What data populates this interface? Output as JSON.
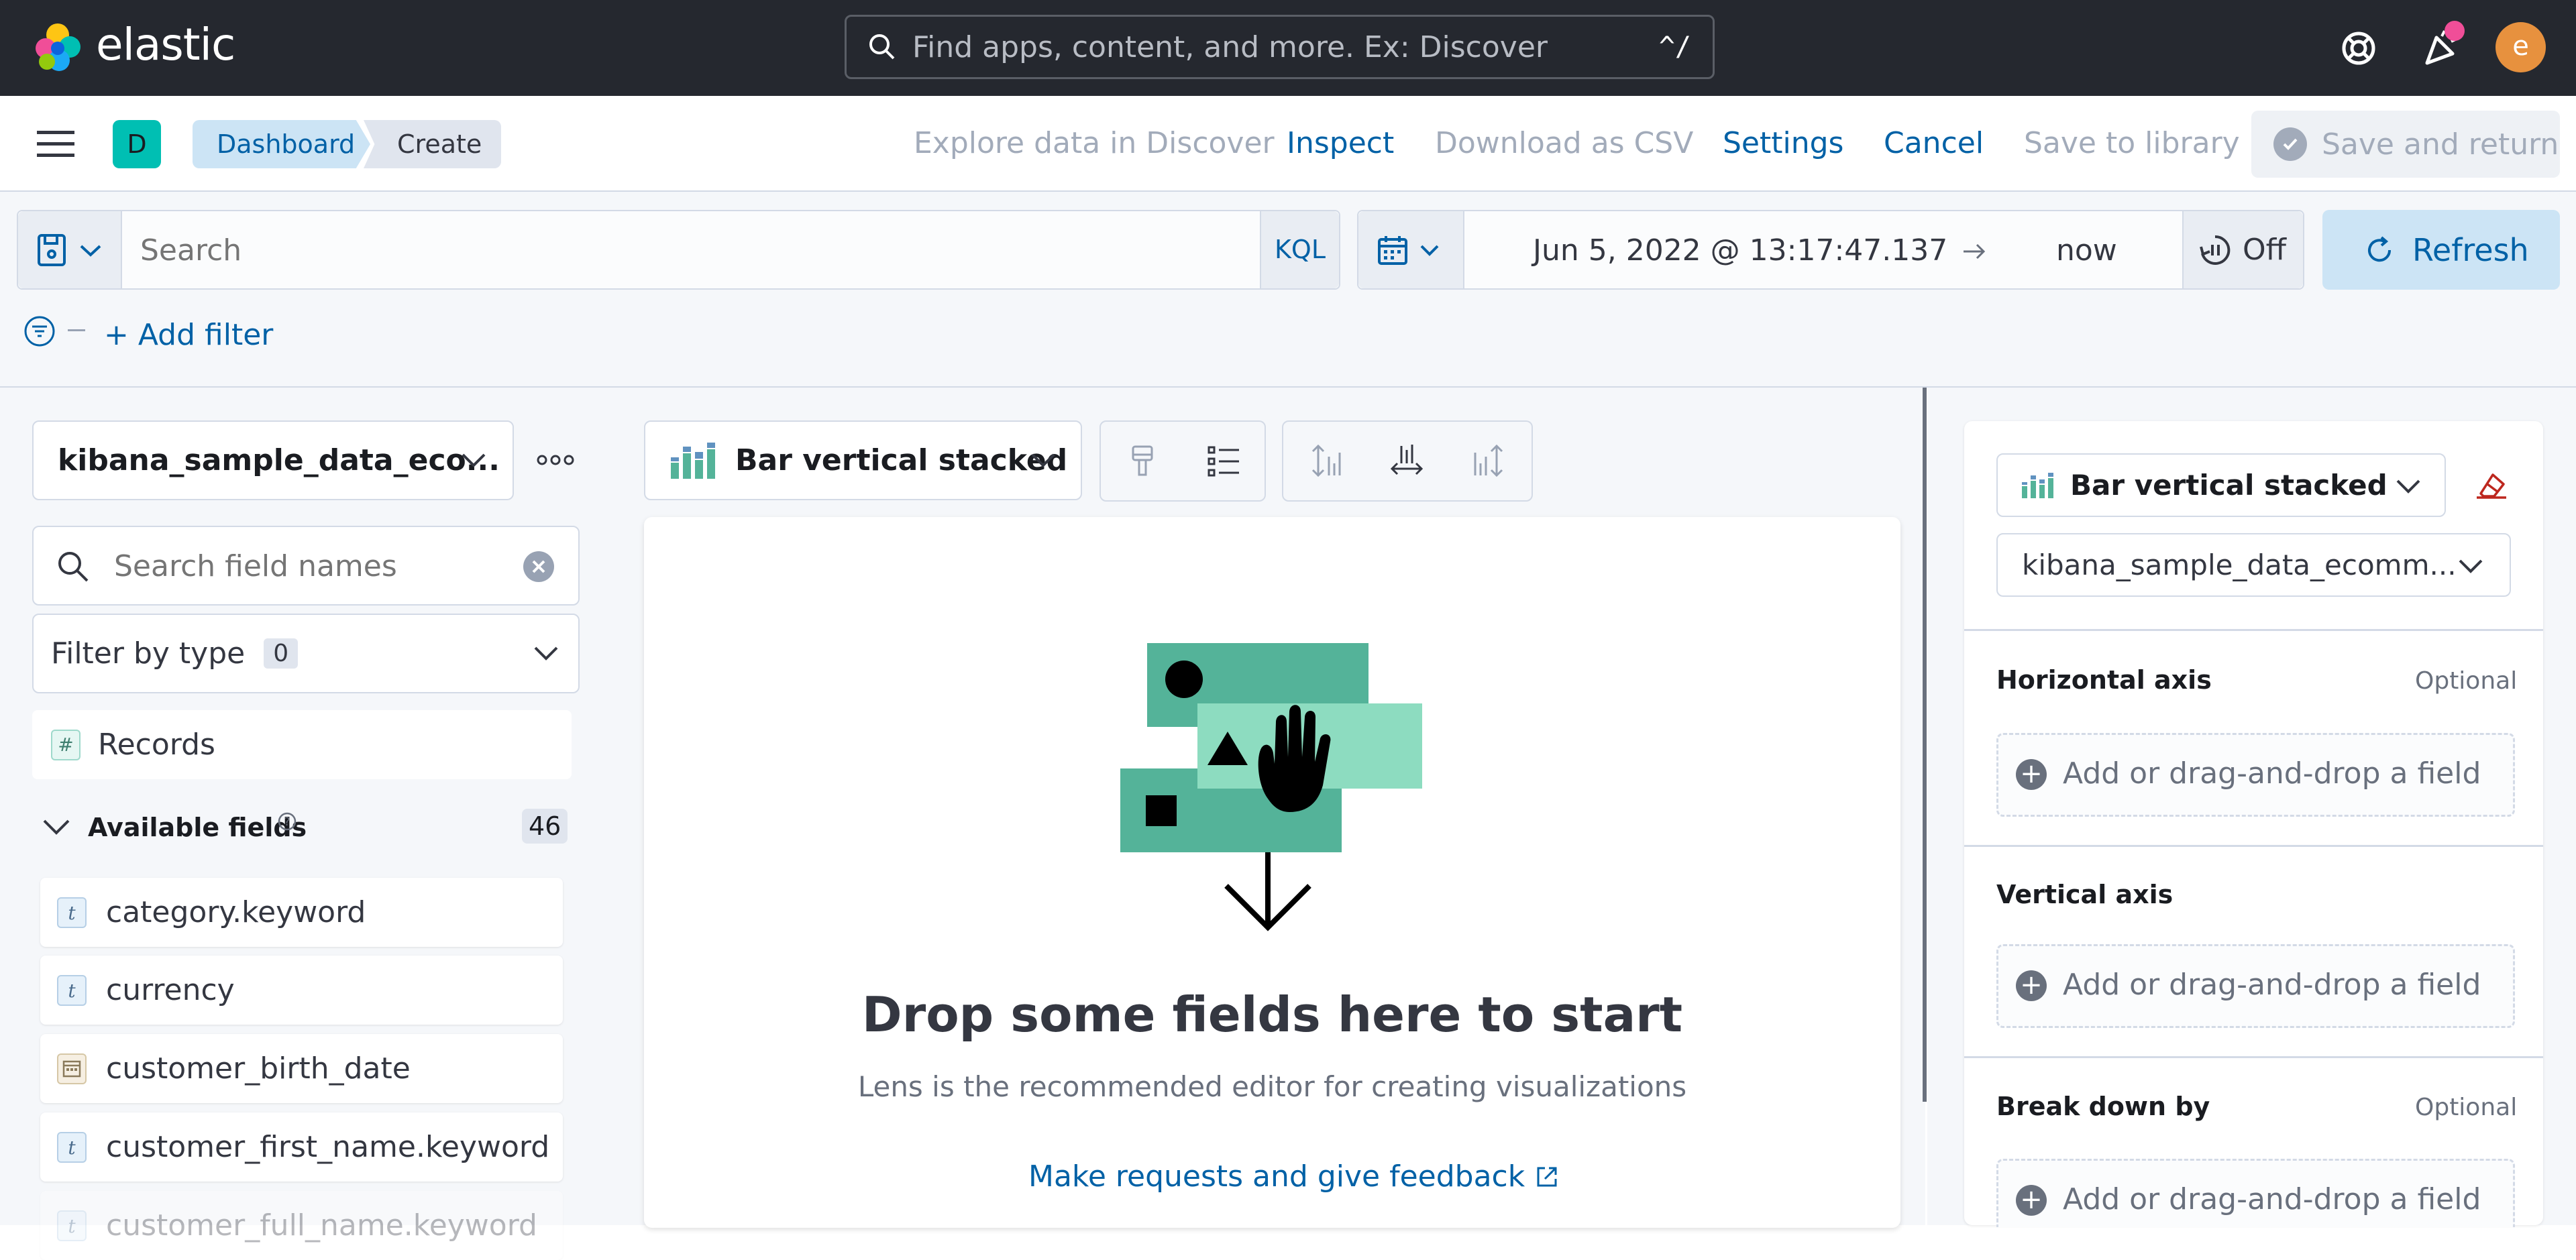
{
  "header": {
    "brand": "elastic",
    "search_placeholder": "Find apps, content, and more. Ex: Discover",
    "search_shortcut": "^/",
    "avatar_letter": "e"
  },
  "nav": {
    "space_letter": "D",
    "breadcrumbs": [
      "Dashboard",
      "Create"
    ],
    "links": {
      "explore": "Explore data in Discover",
      "inspect": "Inspect",
      "download": "Download as CSV",
      "settings": "Settings",
      "cancel": "Cancel",
      "save_library": "Save to library",
      "save_return": "Save and return"
    }
  },
  "query": {
    "search_placeholder": "Search",
    "language": "KQL",
    "start_date": "Jun 5, 2022 @ 13:17:47.137",
    "end_date": "now",
    "auto_refresh": "Off",
    "refresh_label": "Refresh",
    "add_filter": "+ Add filter"
  },
  "left": {
    "data_view": "kibana_sample_data_eco...",
    "field_search_placeholder": "Search field names",
    "filter_by_type": "Filter by type",
    "filter_count": "0",
    "records": "Records",
    "available_fields_label": "Available fields",
    "available_fields_count": "46",
    "fields": [
      {
        "type": "t",
        "name": "category.keyword"
      },
      {
        "type": "t",
        "name": "currency"
      },
      {
        "type": "date",
        "name": "customer_birth_date"
      },
      {
        "type": "t",
        "name": "customer_first_name.keyword"
      },
      {
        "type": "t",
        "name": "customer_full_name.keyword"
      }
    ]
  },
  "center": {
    "chart_type": "Bar vertical stacked",
    "empty_title": "Drop some fields here to start",
    "empty_subtitle": "Lens is the recommended editor for creating visualizations",
    "feedback_link": "Make requests and give feedback"
  },
  "right": {
    "chart_type": "Bar vertical stacked",
    "data_view": "kibana_sample_data_ecomm...",
    "sections": [
      {
        "title": "Horizontal axis",
        "optional": "Optional",
        "placeholder": "Add or drag-and-drop a field"
      },
      {
        "title": "Vertical axis",
        "optional": "",
        "placeholder": "Add or drag-and-drop a field"
      },
      {
        "title": "Break down by",
        "optional": "Optional",
        "placeholder": "Add or drag-and-drop a field"
      }
    ]
  },
  "colors": {
    "topbar": "#25282f",
    "link_blue": "#0061a6",
    "accent_teal": "#00bfb3",
    "illustration_green": "#54b399"
  }
}
